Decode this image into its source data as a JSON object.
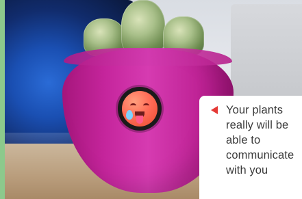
{
  "caption": {
    "text": "Your plants really will be able to communicate with you"
  },
  "colors": {
    "frame_green": "#8cc98c",
    "caption_bg": "#ffffff",
    "arrow_red": "#e53935",
    "pot_pink": "#c5259c"
  },
  "icons": {
    "caption_arrow": "left-triangle-icon",
    "screen_face": "hot-face-emoji-icon"
  }
}
